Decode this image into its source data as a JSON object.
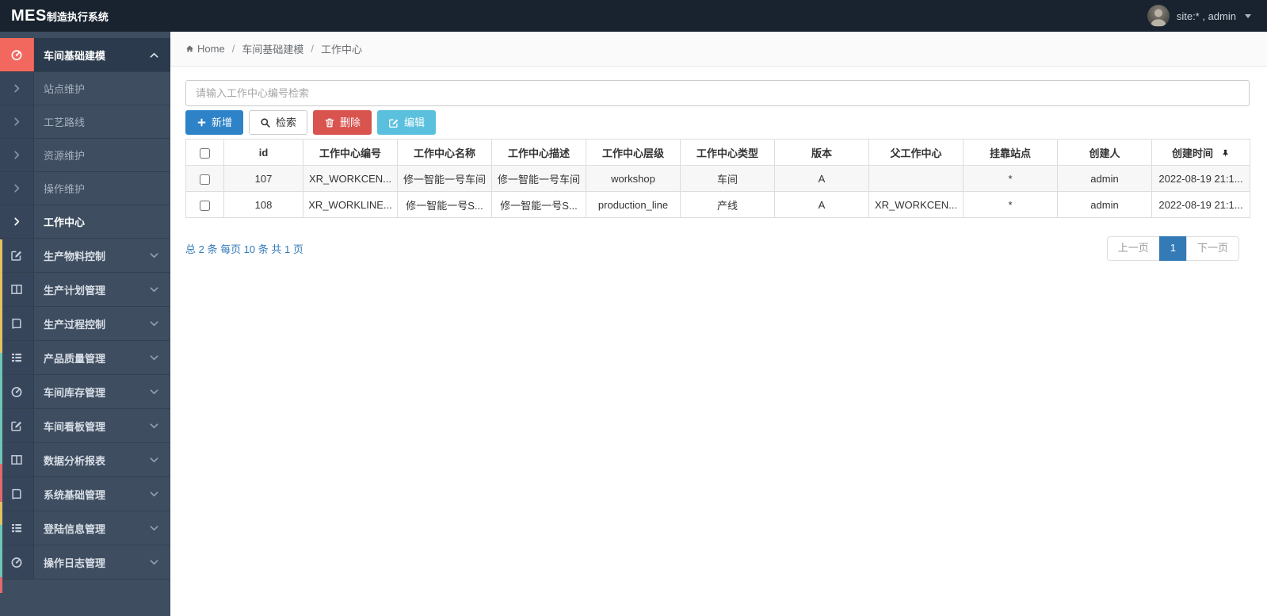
{
  "theme": {
    "topbar": "#18232f",
    "sidebar": "#3e4d60",
    "sidebar_gutter": "#37455a",
    "sidebar_active": "#2b3a4c",
    "accent_red": "#f3685e",
    "primary": "#2e83c8",
    "info": "#5bc0de",
    "danger": "#d9534f",
    "link": "#337ab7",
    "scroll_yellow": "#e5c162",
    "scroll_teal": "#6fc6b4",
    "scroll_red": "#e4696f"
  },
  "topbar": {
    "logo_main": "MES",
    "logo_sub": "制造执行系统",
    "user_label": "site:* , admin"
  },
  "sidebar": {
    "items": [
      {
        "type": "parent",
        "label": "车间基础建模",
        "icon": "dashboard-icon",
        "active": true,
        "expanded": true
      },
      {
        "type": "sub",
        "label": "站点维护"
      },
      {
        "type": "sub",
        "label": "工艺路线"
      },
      {
        "type": "sub",
        "label": "资源维护"
      },
      {
        "type": "sub",
        "label": "操作维护"
      },
      {
        "type": "sub",
        "label": "工作中心",
        "active": true
      },
      {
        "type": "parent",
        "label": "生产物料控制",
        "icon": "edit-icon"
      },
      {
        "type": "parent",
        "label": "生产计划管理",
        "icon": "columns-icon"
      },
      {
        "type": "parent",
        "label": "生产过程控制",
        "icon": "book-icon"
      },
      {
        "type": "parent",
        "label": "产品质量管理",
        "icon": "list-icon"
      },
      {
        "type": "parent",
        "label": "车间库存管理",
        "icon": "dashboard-icon"
      },
      {
        "type": "parent",
        "label": "车间看板管理",
        "icon": "edit-icon"
      },
      {
        "type": "parent",
        "label": "数据分析报表",
        "icon": "columns-icon"
      },
      {
        "type": "parent",
        "label": "系统基础管理",
        "icon": "book-icon"
      },
      {
        "type": "parent",
        "label": "登陆信息管理",
        "icon": "list-icon"
      },
      {
        "type": "parent",
        "label": "操作日志管理",
        "icon": "dashboard-icon"
      }
    ]
  },
  "breadcrumb": {
    "items": [
      "Home",
      "车间基础建模",
      "工作中心"
    ],
    "separator": "/"
  },
  "search": {
    "placeholder": "请输入工作中心编号检索",
    "value": ""
  },
  "toolbar": {
    "add_label": "新增",
    "search_label": "检索",
    "delete_label": "删除",
    "edit_label": "编辑"
  },
  "table": {
    "columns": [
      "id",
      "工作中心编号",
      "工作中心名称",
      "工作中心描述",
      "工作中心层级",
      "工作中心类型",
      "版本",
      "父工作中心",
      "挂靠站点",
      "创建人",
      "创建时间"
    ],
    "rows": [
      {
        "checked": false,
        "cells": [
          "107",
          "XR_WORKCEN...",
          "修一智能一号车间",
          "修一智能一号车间",
          "workshop",
          "车间",
          "A",
          "",
          "*",
          "admin",
          "2022-08-19 21:1..."
        ]
      },
      {
        "checked": false,
        "cells": [
          "108",
          "XR_WORKLINE...",
          "修一智能一号S...",
          "修一智能一号S...",
          "production_line",
          "产线",
          "A",
          "XR_WORKCEN...",
          "*",
          "admin",
          "2022-08-19 21:1..."
        ]
      }
    ]
  },
  "pagination": {
    "summary": "总 2 条 每页 10 条 共 1 页",
    "prev_label": "上一页",
    "current_page": "1",
    "next_label": "下一页"
  }
}
